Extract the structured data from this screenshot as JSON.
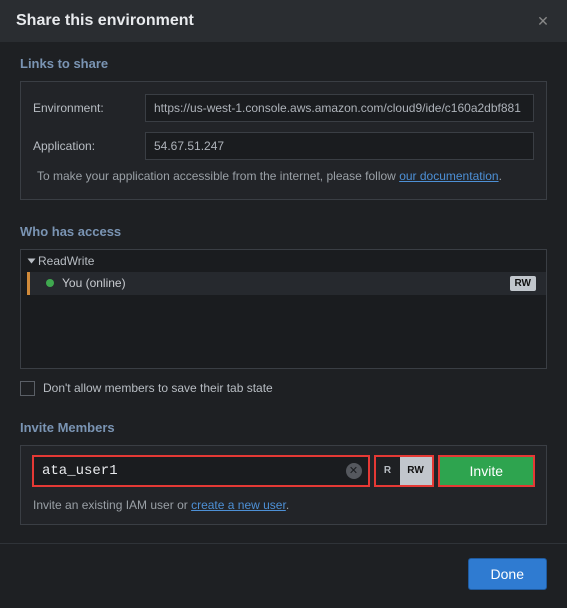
{
  "header": {
    "title": "Share this environment"
  },
  "links_section": {
    "title": "Links to share",
    "env_label": "Environment:",
    "env_value": "https://us-west-1.console.aws.amazon.com/cloud9/ide/c160a2dbf881",
    "app_label": "Application:",
    "app_value": "54.67.51.247",
    "hint_prefix": "To make your application accessible from the internet, please follow ",
    "hint_link": "our documentation",
    "hint_suffix": "."
  },
  "access_section": {
    "title": "Who has access",
    "group": "ReadWrite",
    "member": "You (online)",
    "badge": "RW",
    "checkbox_label": "Don't allow members to save their tab state"
  },
  "invite_section": {
    "title": "Invite Members",
    "input_value": "ata_user1",
    "perm_r": "R",
    "perm_rw": "RW",
    "invite_btn": "Invite",
    "hint_prefix": "Invite an existing IAM user or ",
    "hint_link": "create a new user",
    "hint_suffix": "."
  },
  "footer": {
    "done": "Done"
  }
}
